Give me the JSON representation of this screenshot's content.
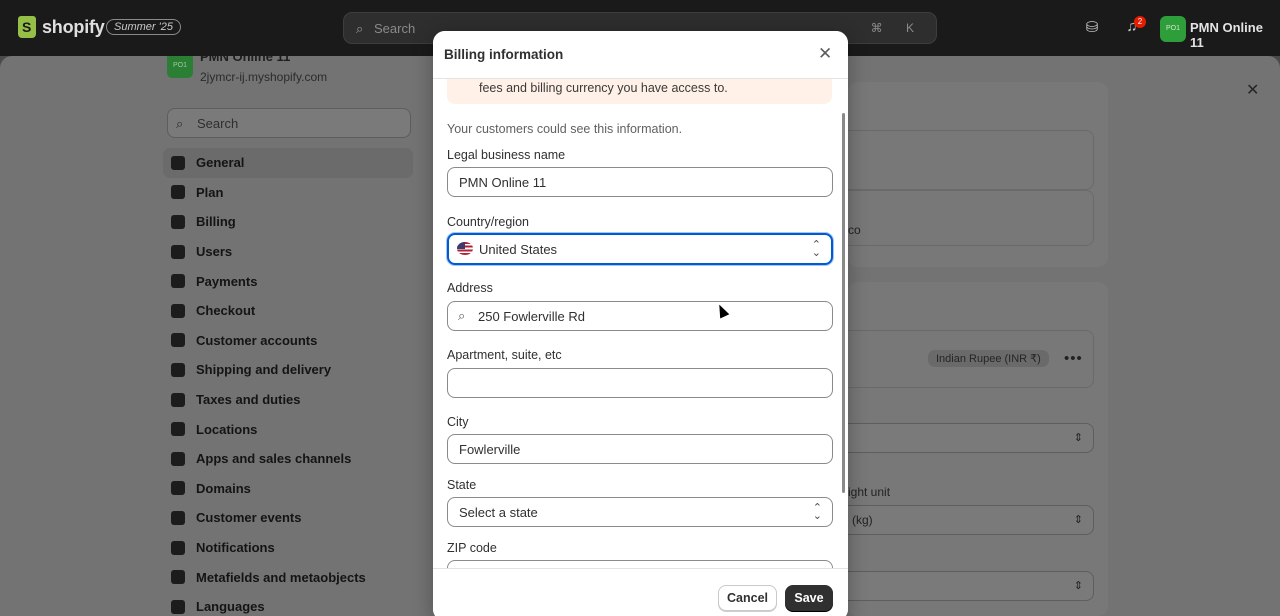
{
  "topbar": {
    "brand": "shopify",
    "edition_badge": "Summer '25",
    "search_placeholder": "Search",
    "search_shortcut": "⌘ K",
    "notification_count": "2",
    "avatar_initials": "PO1",
    "store_name": "PMN Online 11"
  },
  "sidebar": {
    "store_title": "PMN Online 11",
    "store_domain": "2jymcr-ij.myshopify.com",
    "search_placeholder": "Search",
    "items": [
      {
        "label": "General",
        "icon": "store-icon",
        "active": true
      },
      {
        "label": "Plan",
        "icon": "chart-icon"
      },
      {
        "label": "Billing",
        "icon": "receipt-icon"
      },
      {
        "label": "Users",
        "icon": "users-icon"
      },
      {
        "label": "Payments",
        "icon": "payment-icon"
      },
      {
        "label": "Checkout",
        "icon": "cart-icon"
      },
      {
        "label": "Customer accounts",
        "icon": "person-icon"
      },
      {
        "label": "Shipping and delivery",
        "icon": "truck-icon"
      },
      {
        "label": "Taxes and duties",
        "icon": "tax-icon"
      },
      {
        "label": "Locations",
        "icon": "location-icon"
      },
      {
        "label": "Apps and sales channels",
        "icon": "apps-icon"
      },
      {
        "label": "Domains",
        "icon": "globe-icon"
      },
      {
        "label": "Customer events",
        "icon": "sparkle-icon"
      },
      {
        "label": "Notifications",
        "icon": "bell-icon"
      },
      {
        "label": "Metafields and metaobjects",
        "icon": "database-icon"
      },
      {
        "label": "Languages",
        "icon": "language-icon"
      }
    ]
  },
  "background": {
    "partial_text_co": "co",
    "currency_pill": "Indian Rupee (INR ₹)",
    "weight_label_partial": "ight unit",
    "weight_value_partial": "(kg)"
  },
  "modal": {
    "title": "Billing information",
    "notice_text": "fees and billing currency you have access to.",
    "helper_text": "Your customers could see this information.",
    "fields": {
      "legal_name": {
        "label": "Legal business name",
        "value": "PMN Online 11"
      },
      "country": {
        "label": "Country/region",
        "value": "United States"
      },
      "address": {
        "label": "Address",
        "value": "250 Fowlerville Rd"
      },
      "apartment": {
        "label": "Apartment, suite, etc",
        "value": ""
      },
      "city": {
        "label": "City",
        "value": "Fowlerville"
      },
      "state": {
        "label": "State",
        "value": "Select a state"
      },
      "zip": {
        "label": "ZIP code",
        "value": ""
      }
    },
    "cancel_label": "Cancel",
    "save_label": "Save"
  },
  "colors": {
    "accent_focus": "#005bd3",
    "primary_button": "#303030",
    "notice_bg": "#fff1e8",
    "brand_green": "#95bf47"
  }
}
